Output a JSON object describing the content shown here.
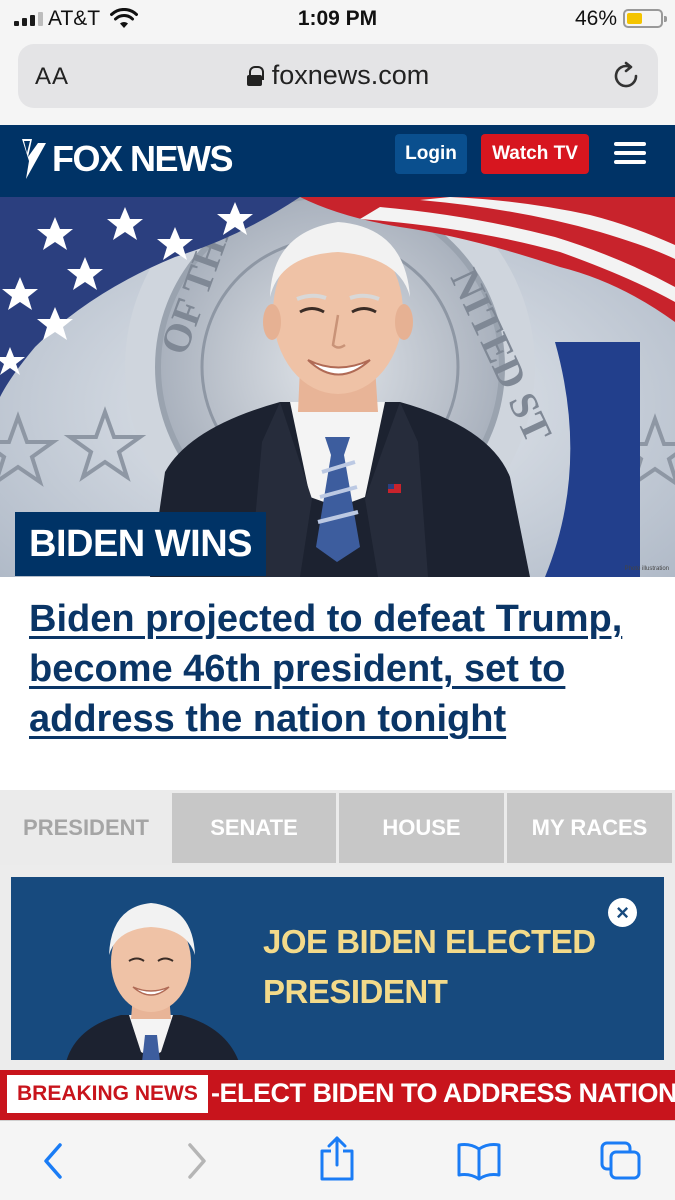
{
  "status_bar": {
    "carrier": "AT&T",
    "time": "1:09 PM",
    "battery_percent": "46%",
    "battery_level": 0.46,
    "icons": [
      "cellular-signal-icon",
      "wifi-icon",
      "battery-icon"
    ]
  },
  "browser": {
    "text_size_label": "AA",
    "url": "foxnews.com",
    "icons": [
      "lock-icon",
      "reload-icon"
    ]
  },
  "header": {
    "logo_text": "FOX NEWS",
    "login_label": "Login",
    "watch_tv_label": "Watch TV",
    "menu_icon": "hamburger-menu-icon"
  },
  "hero": {
    "label": "BIDEN WINS",
    "credit": "Photo illustration"
  },
  "headline": "Biden projected to defeat Trump, become 46th president, set to address the nation tonight",
  "tabs": [
    {
      "label": "PRESIDENT",
      "active": true
    },
    {
      "label": "SENATE",
      "active": false
    },
    {
      "label": "HOUSE",
      "active": false
    },
    {
      "label": "MY RACES",
      "active": false
    }
  ],
  "result_card": {
    "title": "JOE BIDEN ELECTED PRESIDENT",
    "close_icon": "close-icon"
  },
  "ticker": {
    "label": "BREAKING NEWS",
    "text": "-ELECT BIDEN TO ADDRESS NATION"
  },
  "toolbar": {
    "icons": [
      "back-icon",
      "forward-icon",
      "share-icon",
      "bookmarks-icon",
      "tabs-icon"
    ]
  },
  "colors": {
    "fox_navy": "#003366",
    "watch_red": "#d7161f",
    "headline_blue": "#0a3566",
    "card_blue": "#174a7e",
    "card_gold": "#f3da8a",
    "breaking_red": "#c8141c",
    "ios_blue": "#1a7cf5"
  }
}
